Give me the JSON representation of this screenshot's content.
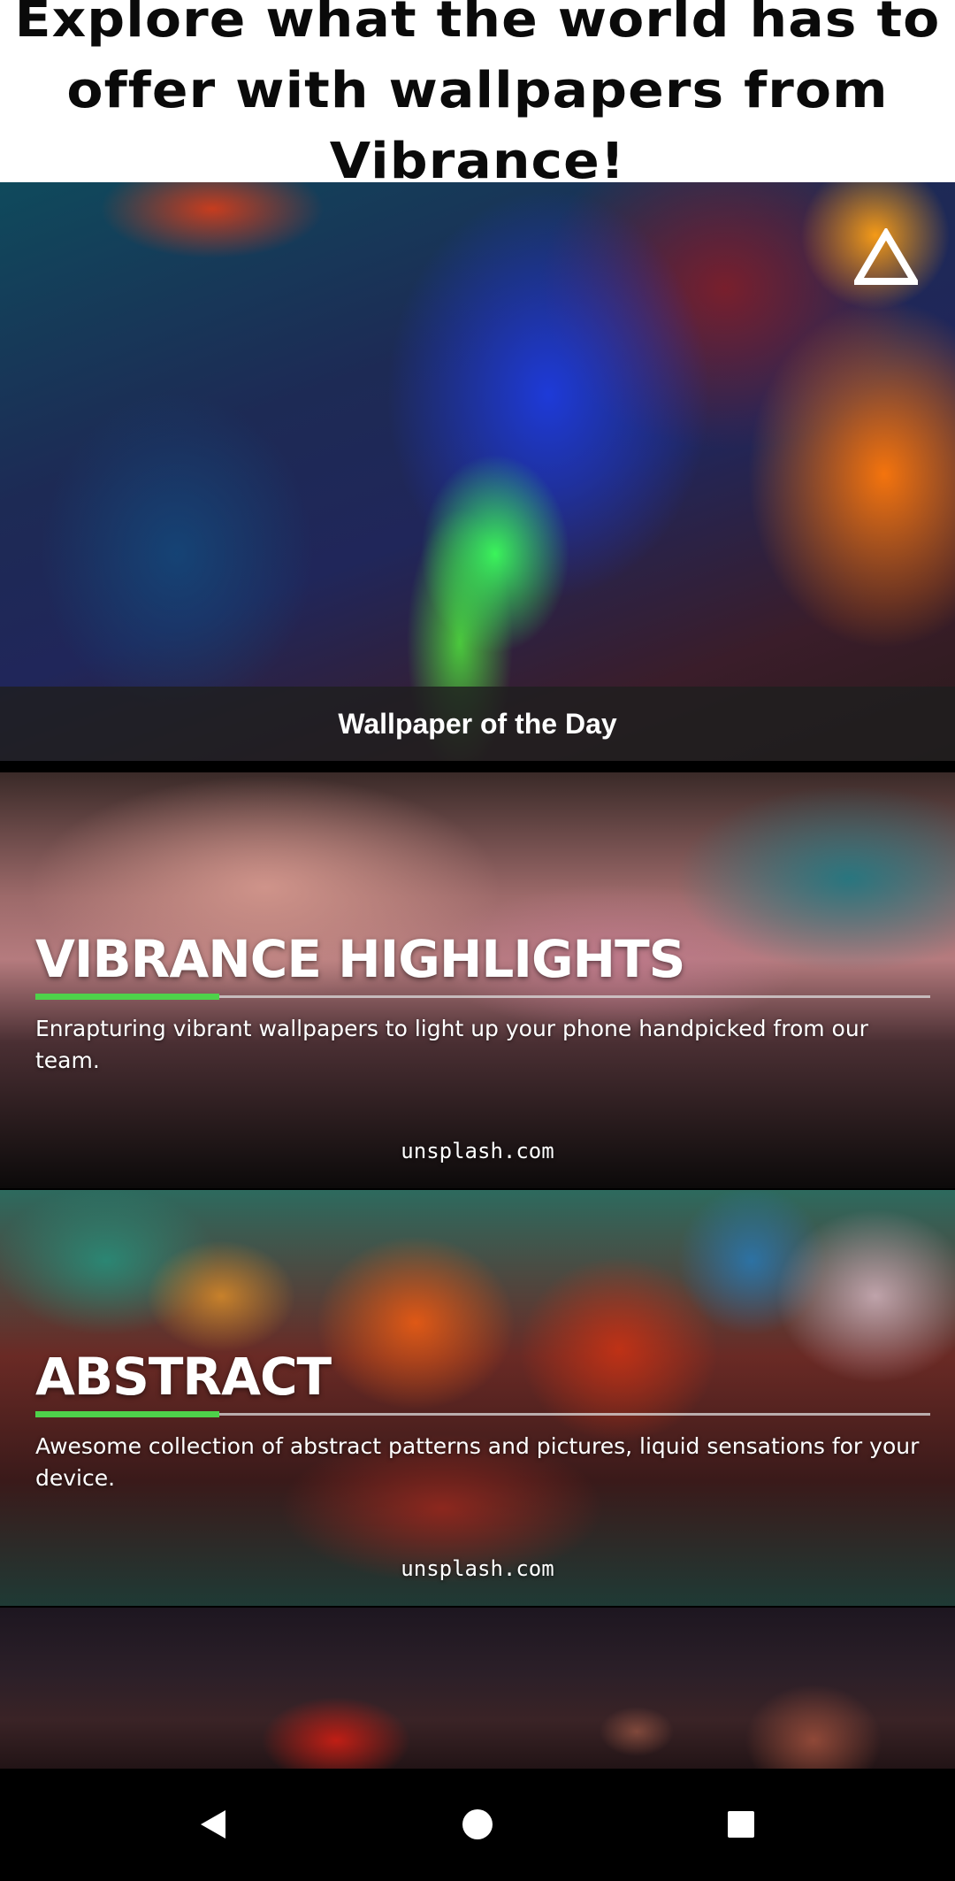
{
  "header": {
    "title": "Explore what the world has to offer with wallpapers from Vibrance!"
  },
  "featured": {
    "caption": "Wallpaper of the Day",
    "logo_icon": "vibrance-triangle-logo-icon"
  },
  "categories": [
    {
      "title": "VIBRANCE HIGHLIGHTS",
      "description": "Enrapturing vibrant wallpapers to light up your phone handpicked from our team.",
      "source": "unsplash.com"
    },
    {
      "title": "ABSTRACT",
      "description": "Awesome collection of abstract patterns and pictures, liquid sensations for your device.",
      "source": "unsplash.com"
    }
  ],
  "navigation_bar": {
    "back_icon": "back-triangle-icon",
    "home_icon": "home-circle-icon",
    "recents_icon": "recents-square-icon"
  },
  "colors": {
    "accent_green": "#4ed24a",
    "header_background": "#ffffff",
    "caption_bar": "#1e1e1e"
  }
}
